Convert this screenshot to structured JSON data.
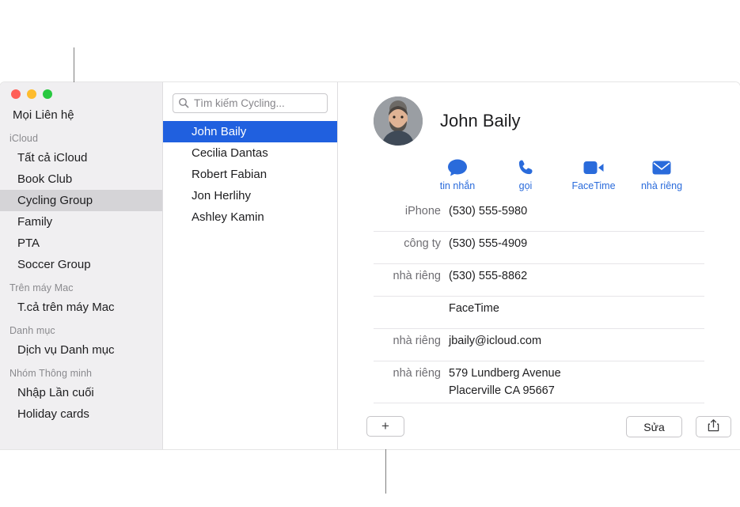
{
  "window": {
    "traffic_lights": [
      "close",
      "minimize",
      "zoom"
    ]
  },
  "sidebar": {
    "top_item": "Mọi Liên hệ",
    "groups": [
      {
        "header": "iCloud",
        "items": [
          "Tất cả iCloud",
          "Book Club",
          "Cycling Group",
          "Family",
          "PTA",
          "Soccer Group"
        ],
        "selected": "Cycling Group"
      },
      {
        "header": "Trên máy Mac",
        "items": [
          "T.cả trên máy Mac"
        ]
      },
      {
        "header": "Danh mục",
        "items": [
          "Dịch vụ Danh mục"
        ]
      },
      {
        "header": "Nhóm Thông minh",
        "items": [
          "Nhập Lần cuối",
          "Holiday cards"
        ]
      }
    ]
  },
  "list": {
    "search_placeholder": "Tìm kiếm Cycling...",
    "search_value": "",
    "contacts": [
      "John Baily",
      "Cecilia Dantas",
      "Robert Fabian",
      "Jon Herlihy",
      "Ashley Kamin"
    ],
    "selected": "John Baily"
  },
  "detail": {
    "name": "John Baily",
    "actions": [
      {
        "label": "tin nhắn",
        "icon": "message-bubble-icon"
      },
      {
        "label": "gọi",
        "icon": "phone-icon"
      },
      {
        "label": "FaceTime",
        "icon": "video-camera-icon"
      },
      {
        "label": "nhà riêng",
        "icon": "envelope-icon"
      }
    ],
    "fields": [
      {
        "label": "iPhone",
        "value": "(530) 555-5980"
      },
      {
        "label": "công ty",
        "value": "(530) 555-4909"
      },
      {
        "label": "nhà riêng",
        "value": "(530) 555-8862"
      },
      {
        "label": "",
        "value": "FaceTime"
      },
      {
        "label": "nhà riêng",
        "value": "jbaily@icloud.com"
      },
      {
        "label": "nhà riêng",
        "value": "579 Lundberg Avenue\nPlacerville CA 95667"
      }
    ]
  },
  "bottom": {
    "add_label": "+",
    "edit_label": "Sửa",
    "share_icon": "share-icon"
  },
  "colors": {
    "selection_blue": "#2060df",
    "action_blue": "#2a6bdb",
    "sidebar_bg": "#f0eff1",
    "sidebar_selected": "#d5d4d7"
  }
}
